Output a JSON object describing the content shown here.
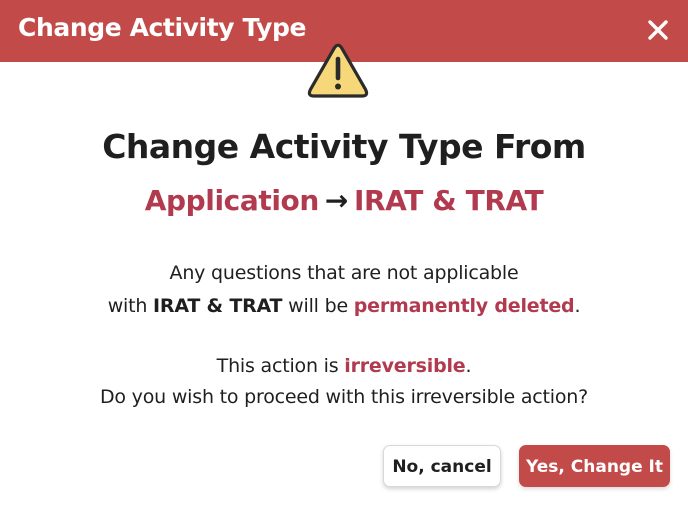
{
  "header": {
    "title": "Change Activity Type",
    "close_icon": "close-icon",
    "color": "#c24b49"
  },
  "warning": {
    "icon": "warning-triangle-icon",
    "fill": "#f6d77a"
  },
  "headline": "Change Activity Type From",
  "type_change": {
    "from": "Application",
    "arrow": "→",
    "to": "IRAT & TRAT",
    "color": "#b23a4f"
  },
  "message": {
    "line1": "Any questions that are not applicable",
    "line2_prefix": "with ",
    "line2_type": "IRAT & TRAT",
    "line2_middle": " will be ",
    "line2_emphasis": "permanently deleted",
    "line2_suffix": ".",
    "line3_prefix": "This action is ",
    "line3_emphasis": "irreversible",
    "line3_suffix": ".",
    "line4": "Do you wish to proceed with this irreversible action?"
  },
  "buttons": {
    "cancel_label": "No, cancel",
    "confirm_label": "Yes, Change It"
  }
}
